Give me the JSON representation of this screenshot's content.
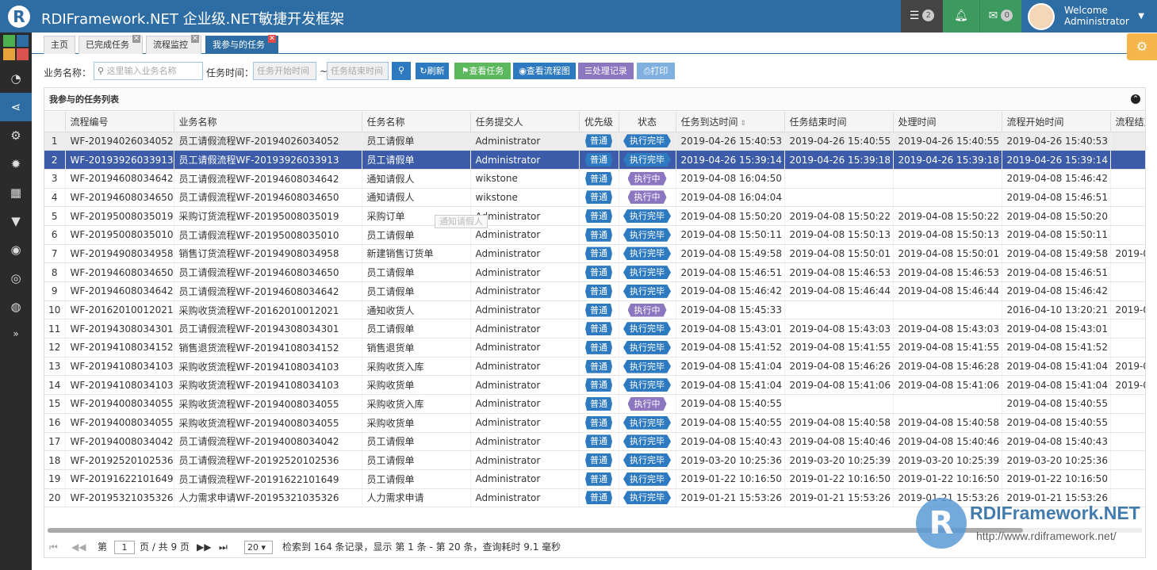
{
  "app": {
    "title": "RDIFramework.NET 企业级.NET敏捷开发框架",
    "logo_letter": "R"
  },
  "topbar": {
    "tasks_count": "2",
    "mail_count": "0",
    "welcome": "Welcome",
    "user": "Administrator"
  },
  "tabs": [
    {
      "label": "主页"
    },
    {
      "label": "已完成任务"
    },
    {
      "label": "流程监控"
    },
    {
      "label": "我参与的任务"
    }
  ],
  "toolbar": {
    "name_label": "业务名称：",
    "name_placeholder": "这里输入业务名称",
    "time_label": "任务时间：",
    "start_placeholder": "任务开始时间",
    "range_sep": "~",
    "end_placeholder": "任务结束时间",
    "refresh": "刷新",
    "view_task": "查看任务",
    "view_flow": "查看流程图",
    "records": "处理记录",
    "print": "打印"
  },
  "panel": {
    "title": "我参与的任务列表"
  },
  "columns": [
    "流程编号",
    "业务名称",
    "任务名称",
    "任务提交人",
    "优先级",
    "状态",
    "任务到达时间",
    "任务结束时间",
    "处理时间",
    "流程开始时间",
    "流程结束"
  ],
  "rows": [
    [
      "1",
      "WF-20194026034052",
      "员工请假流程WF-20194026034052",
      "员工请假单",
      "Administrator",
      "普通",
      "执行完毕",
      "2019-04-26 15:40:53",
      "2019-04-26 15:40:55",
      "2019-04-26 15:40:55",
      "2019-04-26 15:40:53",
      ""
    ],
    [
      "2",
      "WF-20193926033913",
      "员工请假流程WF-20193926033913",
      "员工请假单",
      "Administrator",
      "普通",
      "执行完毕",
      "2019-04-26 15:39:14",
      "2019-04-26 15:39:18",
      "2019-04-26 15:39:18",
      "2019-04-26 15:39:14",
      ""
    ],
    [
      "3",
      "WF-20194608034642",
      "员工请假流程WF-20194608034642",
      "通知请假人",
      "wikstone",
      "普通",
      "执行中",
      "2019-04-08 16:04:50",
      "",
      "",
      "2019-04-08 15:46:42",
      ""
    ],
    [
      "4",
      "WF-20194608034650",
      "员工请假流程WF-20194608034650",
      "通知请假人",
      "wikstone",
      "普通",
      "执行中",
      "2019-04-08 16:04:04",
      "",
      "",
      "2019-04-08 15:46:51",
      ""
    ],
    [
      "5",
      "WF-20195008035019",
      "采购订货流程WF-20195008035019",
      "采购订单",
      "Administrator",
      "普通",
      "执行完毕",
      "2019-04-08 15:50:20",
      "2019-04-08 15:50:22",
      "2019-04-08 15:50:22",
      "2019-04-08 15:50:20",
      ""
    ],
    [
      "6",
      "WF-20195008035010",
      "员工请假流程WF-20195008035010",
      "员工请假单",
      "Administrator",
      "普通",
      "执行完毕",
      "2019-04-08 15:50:11",
      "2019-04-08 15:50:13",
      "2019-04-08 15:50:13",
      "2019-04-08 15:50:11",
      ""
    ],
    [
      "7",
      "WF-20194908034958",
      "销售订货流程WF-20194908034958",
      "新建销售订货单",
      "Administrator",
      "普通",
      "执行完毕",
      "2019-04-08 15:49:58",
      "2019-04-08 15:50:01",
      "2019-04-08 15:50:01",
      "2019-04-08 15:49:58",
      "2019-0"
    ],
    [
      "8",
      "WF-20194608034650",
      "员工请假流程WF-20194608034650",
      "员工请假单",
      "Administrator",
      "普通",
      "执行完毕",
      "2019-04-08 15:46:51",
      "2019-04-08 15:46:53",
      "2019-04-08 15:46:53",
      "2019-04-08 15:46:51",
      ""
    ],
    [
      "9",
      "WF-20194608034642",
      "员工请假流程WF-20194608034642",
      "员工请假单",
      "Administrator",
      "普通",
      "执行完毕",
      "2019-04-08 15:46:42",
      "2019-04-08 15:46:44",
      "2019-04-08 15:46:44",
      "2019-04-08 15:46:42",
      ""
    ],
    [
      "10",
      "WF-20162010012021",
      "采购收货流程WF-20162010012021",
      "通知收货人",
      "Administrator",
      "普通",
      "执行中",
      "2019-04-08 15:45:33",
      "",
      "",
      "2016-04-10 13:20:21",
      "2019-0"
    ],
    [
      "11",
      "WF-20194308034301",
      "员工请假流程WF-20194308034301",
      "员工请假单",
      "Administrator",
      "普通",
      "执行完毕",
      "2019-04-08 15:43:01",
      "2019-04-08 15:43:03",
      "2019-04-08 15:43:03",
      "2019-04-08 15:43:01",
      ""
    ],
    [
      "12",
      "WF-20194108034152",
      "销售退货流程WF-20194108034152",
      "销售退货单",
      "Administrator",
      "普通",
      "执行完毕",
      "2019-04-08 15:41:52",
      "2019-04-08 15:41:55",
      "2019-04-08 15:41:55",
      "2019-04-08 15:41:52",
      ""
    ],
    [
      "13",
      "WF-20194108034103",
      "采购收货流程WF-20194108034103",
      "采购收货入库",
      "Administrator",
      "普通",
      "执行完毕",
      "2019-04-08 15:41:04",
      "2019-04-08 15:46:26",
      "2019-04-08 15:46:28",
      "2019-04-08 15:41:04",
      "2019-0"
    ],
    [
      "14",
      "WF-20194108034103",
      "采购收货流程WF-20194108034103",
      "采购收货单",
      "Administrator",
      "普通",
      "执行完毕",
      "2019-04-08 15:41:04",
      "2019-04-08 15:41:06",
      "2019-04-08 15:41:06",
      "2019-04-08 15:41:04",
      "2019-0"
    ],
    [
      "15",
      "WF-20194008034055",
      "采购收货流程WF-20194008034055",
      "采购收货入库",
      "Administrator",
      "普通",
      "执行中",
      "2019-04-08 15:40:55",
      "",
      "",
      "2019-04-08 15:40:55",
      ""
    ],
    [
      "16",
      "WF-20194008034055",
      "采购收货流程WF-20194008034055",
      "采购收货单",
      "Administrator",
      "普通",
      "执行完毕",
      "2019-04-08 15:40:55",
      "2019-04-08 15:40:58",
      "2019-04-08 15:40:58",
      "2019-04-08 15:40:55",
      ""
    ],
    [
      "17",
      "WF-20194008034042",
      "员工请假流程WF-20194008034042",
      "员工请假单",
      "Administrator",
      "普通",
      "执行完毕",
      "2019-04-08 15:40:43",
      "2019-04-08 15:40:46",
      "2019-04-08 15:40:46",
      "2019-04-08 15:40:43",
      ""
    ],
    [
      "18",
      "WF-20192520102536",
      "员工请假流程WF-20192520102536",
      "员工请假单",
      "Administrator",
      "普通",
      "执行完毕",
      "2019-03-20 10:25:36",
      "2019-03-20 10:25:39",
      "2019-03-20 10:25:39",
      "2019-03-20 10:25:36",
      ""
    ],
    [
      "19",
      "WF-20191622101649",
      "员工请假流程WF-20191622101649",
      "员工请假单",
      "Administrator",
      "普通",
      "执行完毕",
      "2019-01-22 10:16:50",
      "2019-01-22 10:16:50",
      "2019-01-22 10:16:50",
      "2019-01-22 10:16:50",
      ""
    ],
    [
      "20",
      "WF-20195321035326",
      "人力需求申请WF-20195321035326",
      "人力需求申请",
      "Administrator",
      "普通",
      "执行完毕",
      "2019-01-21 15:53:26",
      "2019-01-21 15:53:26",
      "2019-01-21 15:53:26",
      "2019-01-21 15:53:26",
      ""
    ]
  ],
  "pager": {
    "page_label": "第",
    "page": "1",
    "of_label": "页 / 共 9 页",
    "page_size": "20",
    "summary": "检索到 164 条记录，显示 第 1 条 - 第 20 条，查询耗时 9.1 毫秒"
  },
  "tooltip": "通知请假人",
  "watermark": {
    "brand": "RDIFramework.NET",
    "url": "http://www.rdiframework.net/"
  },
  "colors": {
    "primary": "#2e6da4",
    "selected_row": "#3c5ba8",
    "running": "#8c76c0",
    "green": "#3c9a5f",
    "orange": "#f5b54b"
  }
}
